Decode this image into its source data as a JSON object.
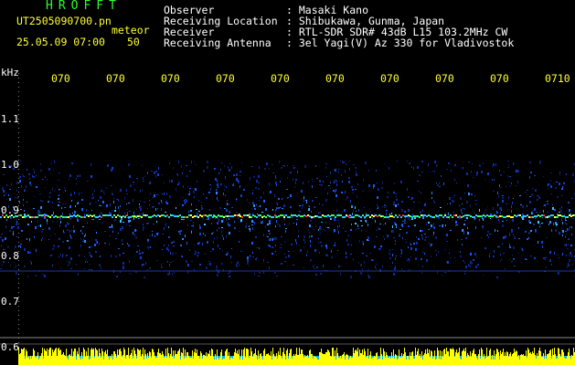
{
  "app": {
    "name": "HROFFT",
    "file": "UT2505090700.pn",
    "mode": "meteor",
    "datetime": "25.05.09 07:00",
    "value": "50"
  },
  "info": [
    {
      "key": "Observer",
      "value": ": Masaki Kano"
    },
    {
      "key": "Receiving Location",
      "value": ": Shibukawa, Gunma, Japan"
    },
    {
      "key": "Receiver",
      "value": ": RTL-SDR SDR# 43dB L15 103.2MHz CW"
    },
    {
      "key": "Receiving Antenna",
      "value": ": 3el Yagi(V) Az 330 for Vladivostok"
    }
  ],
  "time_axis": [
    "070",
    "070",
    "070",
    "070",
    "070",
    "070",
    "070",
    "070",
    "070",
    "0710"
  ],
  "freq_axis": {
    "unit": "kHz",
    "ticks": [
      "1.1",
      "1.0",
      "0.9",
      "0.8",
      "0.7",
      "0.6"
    ]
  },
  "colors": {
    "app_name": "#2bff2b",
    "labels": "#ffff33",
    "info": "#ffffff",
    "background": "#000000",
    "signal_level": "#ffff00",
    "signal_base": "#00b4ff"
  }
}
